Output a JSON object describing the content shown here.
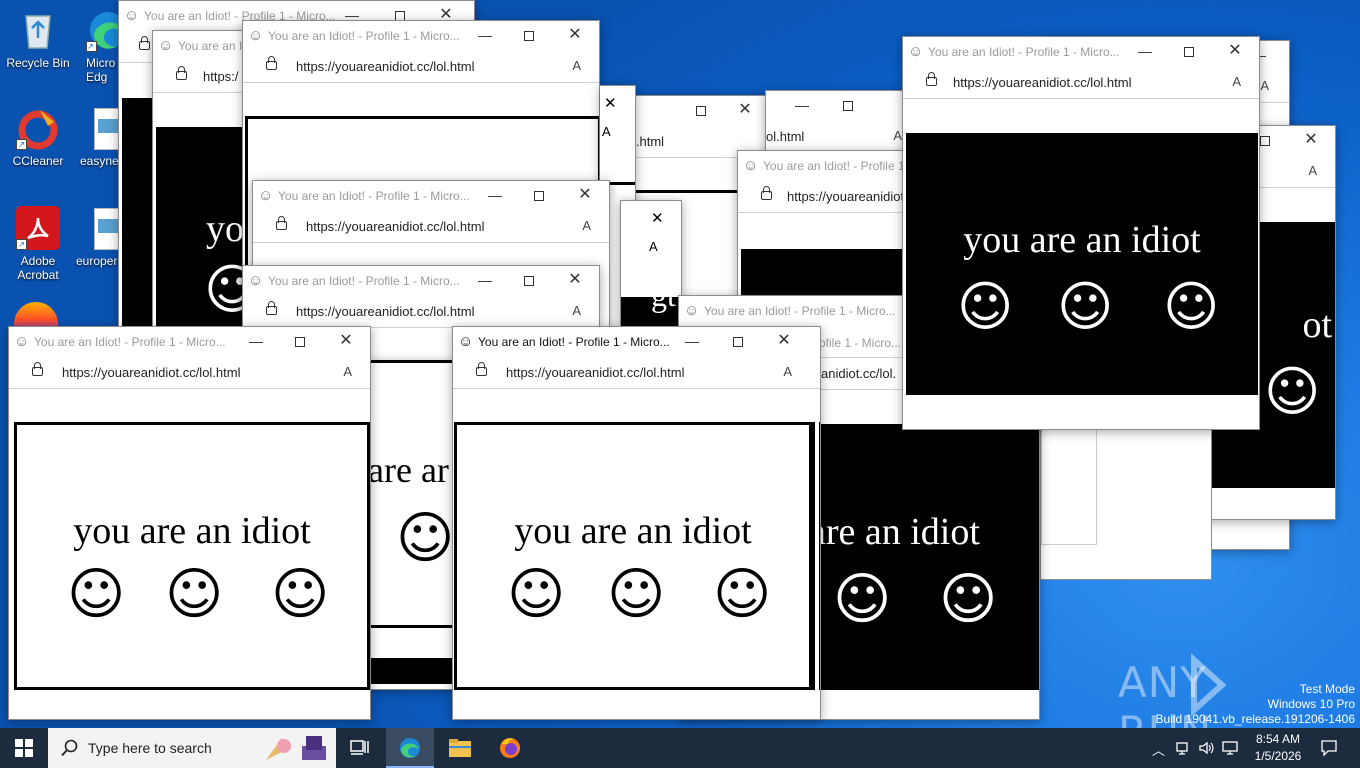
{
  "desktop_icons": [
    {
      "label": "Recycle Bin",
      "icon": "recycle-bin-icon"
    },
    {
      "label": "Micro Edg",
      "icon": "edge-icon"
    },
    {
      "label": "CCleaner",
      "icon": "ccleaner-icon"
    },
    {
      "label": "easyne",
      "icon": "file-icon"
    },
    {
      "label": "Adobe Acrobat",
      "icon": "acrobat-icon"
    },
    {
      "label": "europer",
      "icon": "file-icon"
    }
  ],
  "popup": {
    "title": "You are an Idiot! - Profile 1 - Micro...",
    "title_short": "You are an Idiot! - Profile 1",
    "title_cut": "You are an Id",
    "title_tail": "ofile 1 - Micro...",
    "url": "https://youareanidiot.cc/lol.html",
    "url_short": "https://youareanidiot",
    "url_cut": "https:/",
    "url_tail1": "l.html",
    "url_tail2": "ol.html",
    "url_tail3": "anidiot.cc/lol.",
    "message": "you are an idiot",
    "message_cut": "you",
    "message_mid": "are ar",
    "message_right": "are an idiot",
    "frag_ot": "ot",
    "frag_gt": "gt",
    "smiley": "☺",
    "read_aloud": "A",
    "minimize": "—",
    "close": "✕"
  },
  "watermark": {
    "brand": "ANY RUN",
    "line1": "Test Mode",
    "line2": "Windows 10 Pro",
    "line3": "Build 19041.vb_release.191206-1406"
  },
  "taskbar": {
    "search_placeholder": "Type here to search",
    "time": "8:54 AM",
    "date": "1/5/2026",
    "pinned": [
      "task-view-icon",
      "edge-icon",
      "file-explorer-icon",
      "firefox-icon"
    ]
  }
}
